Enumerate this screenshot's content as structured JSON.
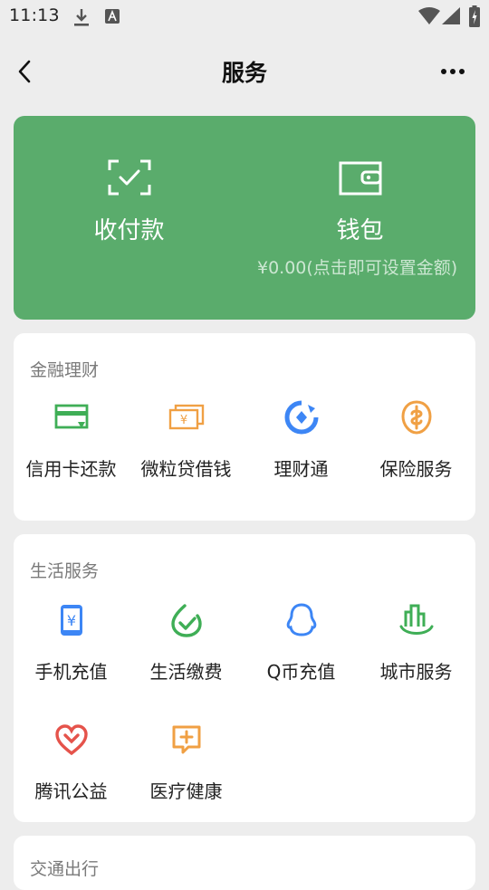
{
  "status_bar": {
    "time": "11:13"
  },
  "nav": {
    "title": "服务"
  },
  "pay_card": {
    "collect_label": "收付款",
    "wallet_label": "钱包",
    "wallet_balance": "¥0.00(点击即可设置金额)",
    "background": "#5aac6c"
  },
  "sections": {
    "finance": {
      "title": "金融理财",
      "items": [
        {
          "label": "信用卡还款",
          "icon": "credit-card-icon"
        },
        {
          "label": "微粒贷借钱",
          "icon": "loan-icon"
        },
        {
          "label": "理财通",
          "icon": "wealth-icon"
        },
        {
          "label": "保险服务",
          "icon": "insurance-icon"
        }
      ]
    },
    "life": {
      "title": "生活服务",
      "items": [
        {
          "label": "手机充值",
          "icon": "phone-recharge-icon"
        },
        {
          "label": "生活缴费",
          "icon": "utility-payment-icon"
        },
        {
          "label": "Q币充值",
          "icon": "qq-coin-icon"
        },
        {
          "label": "城市服务",
          "icon": "city-service-icon"
        },
        {
          "label": "腾讯公益",
          "icon": "charity-icon"
        },
        {
          "label": "医疗健康",
          "icon": "medical-icon"
        }
      ]
    },
    "transport": {
      "title": "交通出行"
    }
  },
  "colors": {
    "background": "#ededed",
    "brand_green": "#5aac6c",
    "icon_green": "#3fae56",
    "icon_orange": "#f0a044",
    "icon_blue": "#3d86f5",
    "icon_red": "#e5534b"
  }
}
